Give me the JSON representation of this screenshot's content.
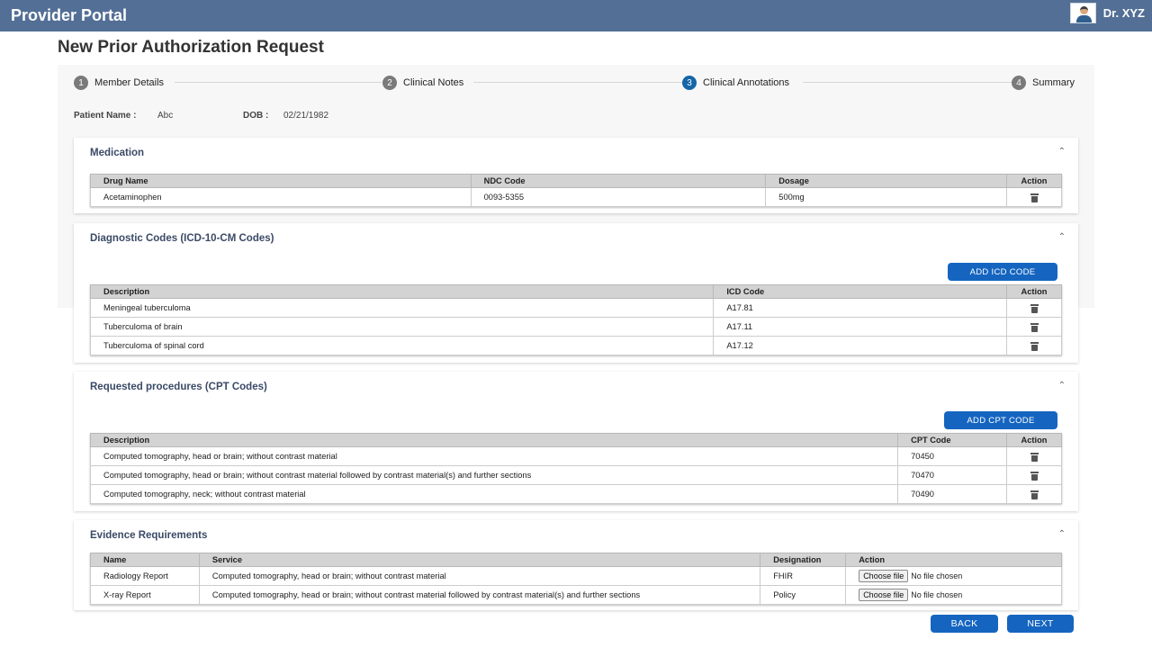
{
  "header": {
    "app_title": "Provider Portal",
    "user_name": "Dr. XYZ",
    "avatar_icon": "doctor-avatar-icon"
  },
  "page_title": "New Prior Authorization Request",
  "stepper": [
    {
      "num": "1",
      "label": "Member Details",
      "active": false
    },
    {
      "num": "2",
      "label": "Clinical Notes",
      "active": false
    },
    {
      "num": "3",
      "label": "Clinical Annotations",
      "active": true
    },
    {
      "num": "4",
      "label": "Summary",
      "active": false
    }
  ],
  "patient": {
    "name_label": "Patient Name :",
    "name_value": "Abc",
    "dob_label": "DOB :",
    "dob_value": "02/21/1982"
  },
  "medication": {
    "title": "Medication",
    "headers": [
      "Drug Name",
      "NDC Code",
      "Dosage",
      "Action"
    ],
    "rows": [
      {
        "drug": "Acetaminophen",
        "ndc": "0093-5355",
        "dosage": "500mg"
      }
    ]
  },
  "diagnostic": {
    "title": "Diagnostic Codes (ICD-10-CM Codes)",
    "add_label": "ADD ICD CODE",
    "headers": [
      "Description",
      "ICD Code",
      "Action"
    ],
    "rows": [
      {
        "description": "Meningeal tuberculoma",
        "code": "A17.81"
      },
      {
        "description": "Tuberculoma of brain",
        "code": "A17.11"
      },
      {
        "description": "Tuberculoma of spinal cord",
        "code": "A17.12"
      }
    ]
  },
  "procedures": {
    "title": "Requested procedures (CPT Codes)",
    "add_label": "ADD CPT CODE",
    "headers": [
      "Description",
      "CPT Code",
      "Action"
    ],
    "rows": [
      {
        "description": "Computed tomography, head or brain; without contrast material",
        "code": "70450"
      },
      {
        "description": "Computed tomography, head or brain; without contrast material followed by contrast material(s) and further sections",
        "code": "70470"
      },
      {
        "description": "Computed tomography, neck; without contrast material",
        "code": "70490"
      }
    ]
  },
  "evidence": {
    "title": "Evidence Requirements",
    "headers": [
      "Name",
      "Service",
      "Designation",
      "Action"
    ],
    "choose_label": "Choose file",
    "no_file_label": "No file chosen",
    "rows": [
      {
        "name": "Radiology Report",
        "service": "Computed tomography, head or brain; without contrast material",
        "designation": "FHIR"
      },
      {
        "name": "X-ray Report",
        "service": "Computed tomography, head or brain; without contrast material followed by contrast material(s) and further sections",
        "designation": "Policy"
      }
    ]
  },
  "footer": {
    "back_label": "BACK",
    "next_label": "NEXT"
  },
  "icons": {
    "delete": "trash-icon",
    "collapse": "chevron-up-icon"
  },
  "colors": {
    "topbar": "#536f96",
    "primary_button": "#1565c0",
    "active_step": "#1565a8"
  }
}
